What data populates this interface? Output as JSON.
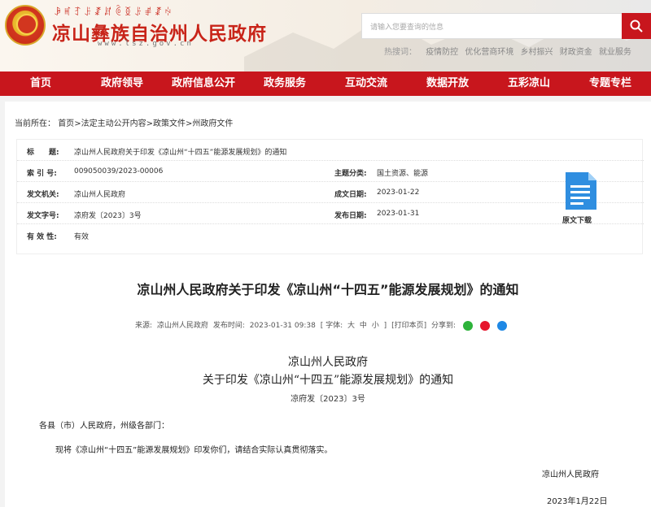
{
  "header": {
    "yi_script": "ꆃꎭꆈꌠꊨꏦꏱꅉꌠꂱꊨꏢ",
    "site_title": "凉山彝族自治州人民政府",
    "site_url": "www.lsz.gov.cn",
    "search_placeholder": "请输入您要查询的信息",
    "hotwords_label": "热搜词：",
    "hotwords": [
      "疫情防控",
      "优化营商环境",
      "乡村振兴",
      "财政资金",
      "就业服务"
    ]
  },
  "nav": [
    "首页",
    "政府领导",
    "政府信息公开",
    "政务服务",
    "互动交流",
    "数据开放",
    "五彩凉山",
    "专题专栏"
  ],
  "breadcrumb": {
    "prefix": "当前所在：",
    "items": [
      "首页",
      "法定主动公开内容",
      "政策文件",
      "州政府文件"
    ],
    "separator": ">"
  },
  "meta": {
    "title_label": "标　　题:",
    "title_value": "凉山州人民政府关于印发《凉山州“十四五”能源发展规划》的通知",
    "index_label": "索 引 号:",
    "index_value": "009050039/2023-00006",
    "topic_label": "主题分类:",
    "topic_value": "国土资源、能源",
    "issuer_label": "发文机关:",
    "issuer_value": "凉山州人民政府",
    "created_label": "成文日期:",
    "created_value": "2023-01-22",
    "docno_label": "发文字号:",
    "docno_value": "凉府发〔2023〕3号",
    "published_label": "发布日期:",
    "published_value": "2023-01-31",
    "validity_label": "有 效 性:",
    "validity_value": "有效",
    "download_label": "原文下载"
  },
  "article": {
    "title": "凉山州人民政府关于印发《凉山州“十四五”能源发展规划》的通知",
    "source_label": "来源:",
    "source_value": "凉山州人民政府",
    "time_label": "发布时间:",
    "time_value": "2023-01-31 09:38",
    "font_label": "[ 字体:",
    "font_large": "大",
    "font_medium": "中",
    "font_small": "小",
    "font_close": "]",
    "print_label": "[打印本页]",
    "share_label": "分享到:",
    "share_icons": [
      "wechat-icon",
      "weibo-icon",
      "qq-icon"
    ]
  },
  "body": {
    "heading1": "凉山州人民政府",
    "heading2": "关于印发《凉山州“十四五”能源发展规划》的通知",
    "doc_no": "凉府发〔2023〕3号",
    "greeting": "各县（市）人民政府，州级各部门：",
    "paragraph": "现将《凉山州“十四五”能源发展规划》印发你们，请结合实际认真贯彻落实。",
    "signature": "凉山州人民政府",
    "date": "2023年1月22日"
  },
  "colors": {
    "brand_red": "#c8161d",
    "title_red": "#c82419",
    "doc_blue": "#2f8ee0"
  }
}
